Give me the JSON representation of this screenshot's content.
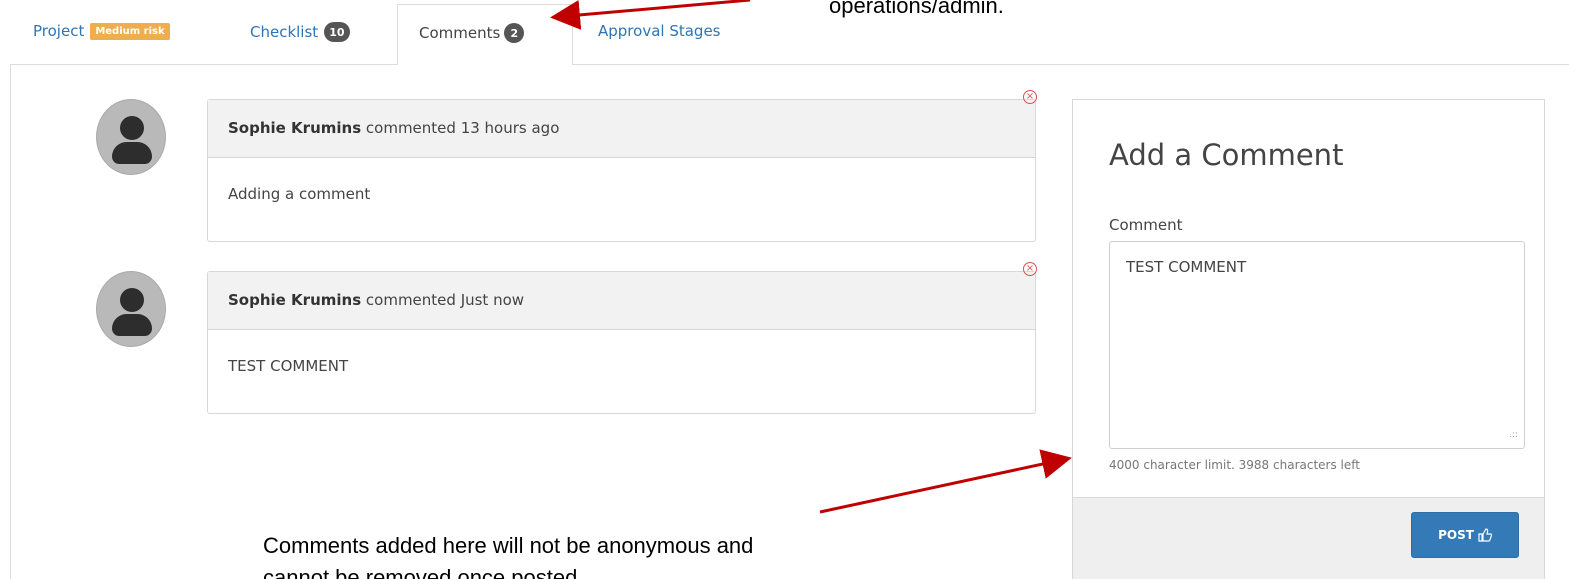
{
  "tabs": {
    "project": {
      "label": "Project",
      "badge": "Medium risk"
    },
    "checklist": {
      "label": "Checklist",
      "count": "10"
    },
    "comments": {
      "label": "Comments",
      "count": "2"
    },
    "approval": {
      "label": "Approval Stages"
    }
  },
  "comments": [
    {
      "author": "Sophie Krumins",
      "meta": " commented 13 hours ago",
      "text": "Adding a comment"
    },
    {
      "author": "Sophie Krumins",
      "meta": " commented Just now",
      "text": "TEST COMMENT"
    }
  ],
  "add_comment": {
    "title": "Add a Comment",
    "label": "Comment",
    "value": "TEST COMMENT",
    "char_info": "4000 character limit. 3988 characters left",
    "post_label": "POST"
  },
  "annotations": {
    "top": "operations/admin.",
    "bottom_line1": "Comments added here will not be anonymous and",
    "bottom_line2": "cannot be removed once posted."
  },
  "colors": {
    "accent": "#337ab7",
    "risk_badge": "#f0ad4e",
    "arrow": "#c00000"
  }
}
